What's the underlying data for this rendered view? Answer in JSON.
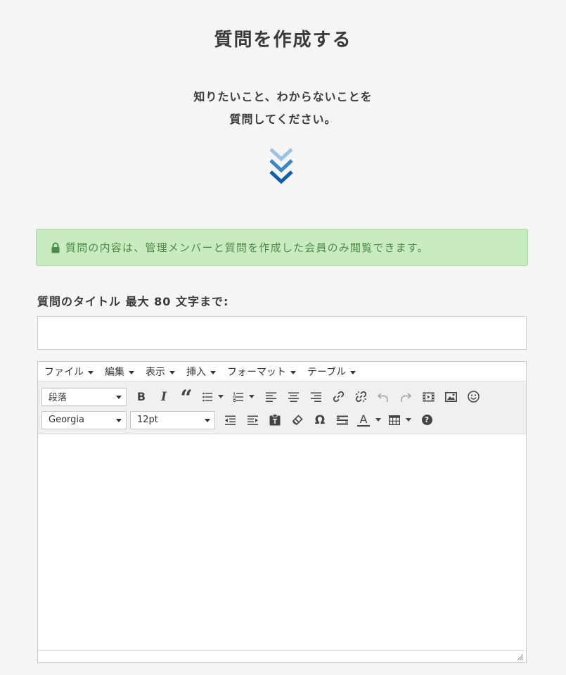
{
  "page": {
    "title": "質問を作成する",
    "intro_line1": "知りたいこと、わからないことを",
    "intro_line2": "質問してください。"
  },
  "notice": {
    "text": "質問の内容は、管理メンバーと質問を作成した会員のみ閲覧できます。",
    "bg_color": "#c8ebc2",
    "text_color": "#4e8a47"
  },
  "form": {
    "title_label": "質問のタイトル 最大 80 文字まで:",
    "title_value": "",
    "title_placeholder": ""
  },
  "editor": {
    "menu": [
      "ファイル",
      "編集",
      "表示",
      "挿入",
      "フォーマット",
      "テーブル"
    ],
    "format_select": "段落",
    "font_select": "Georgia",
    "size_select": "12pt",
    "toolbar_row1_icons": [
      "bold-icon",
      "italic-icon",
      "blockquote-icon",
      "bullet-list-icon",
      "numbered-list-icon",
      "align-left-icon",
      "align-center-icon",
      "align-right-icon",
      "link-icon",
      "unlink-icon",
      "undo-icon",
      "redo-icon",
      "media-icon",
      "image-icon",
      "emoticon-icon"
    ],
    "toolbar_row2_icons": [
      "outdent-icon",
      "indent-icon",
      "paste-text-icon",
      "clear-format-icon",
      "special-char-icon",
      "horizontal-rule-icon",
      "text-color-icon",
      "table-icon",
      "help-icon"
    ],
    "bold_glyph": "B",
    "italic_glyph": "I",
    "quote_glyph": "“",
    "omega_glyph": "Ω",
    "text_color_glyph": "A",
    "help_glyph": "?"
  },
  "colors": {
    "chevron_light": "#9cc3e4",
    "chevron_mid": "#3d86c6",
    "chevron_dark": "#0f5da6"
  }
}
